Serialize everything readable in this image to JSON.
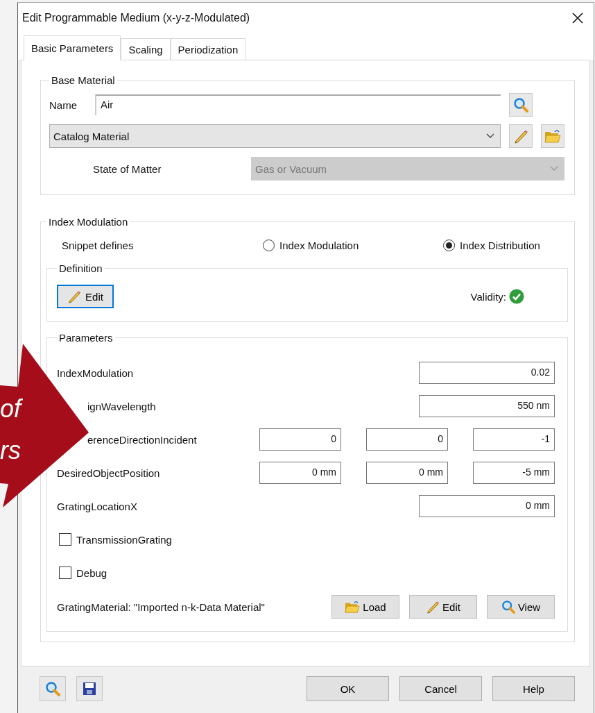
{
  "window": {
    "title": "Edit Programmable Medium (x-y-z-Modulated)"
  },
  "tabs": [
    {
      "label": "Basic Parameters",
      "selected": true
    },
    {
      "label": "Scaling",
      "selected": false
    },
    {
      "label": "Periodization",
      "selected": false
    }
  ],
  "base_material": {
    "title": "Base Material",
    "name_label": "Name",
    "name_value": "Air",
    "catalog": "Catalog Material",
    "state_label": "State of Matter",
    "state_value": "Gas or Vacuum",
    "state_disabled": true
  },
  "index_modulation": {
    "title": "Index Modulation",
    "snippet_label": "Snippet defines",
    "options": [
      {
        "label": "Index Modulation",
        "selected": false
      },
      {
        "label": "Index Distribution",
        "selected": true
      }
    ],
    "definition": {
      "title": "Definition",
      "edit_button": "Edit",
      "validity_label": "Validity:",
      "valid": true
    },
    "parameters": {
      "title": "Parameters",
      "rows": [
        {
          "kind": "inputs",
          "label": "IndexModulation",
          "partly_hidden": false,
          "values": [
            "0.02"
          ]
        },
        {
          "kind": "inputs",
          "label": "ignWavelength",
          "partly_hidden": true,
          "values": [
            "550 nm"
          ]
        },
        {
          "kind": "inputs",
          "label": "erenceDirectionIncident",
          "partly_hidden": true,
          "values": [
            "0",
            "0",
            "-1"
          ]
        },
        {
          "kind": "inputs",
          "label": "DesiredObjectPosition",
          "partly_hidden": false,
          "values": [
            "0 mm",
            "0 mm",
            "-5 mm"
          ]
        },
        {
          "kind": "inputs",
          "label": "GratingLocationX",
          "partly_hidden": false,
          "values": [
            "0 mm"
          ]
        },
        {
          "kind": "checkbox",
          "label": "TransmissionGrating",
          "checked": false
        },
        {
          "kind": "checkbox",
          "label": "Debug",
          "checked": false
        },
        {
          "kind": "material",
          "label": "GratingMaterial: \"Imported n-k-Data Material\"",
          "buttons": [
            {
              "kind": "load",
              "label": "Load"
            },
            {
              "kind": "edit",
              "label": "Edit"
            },
            {
              "kind": "view",
              "label": "View"
            }
          ]
        }
      ]
    }
  },
  "footer": {
    "buttons": [
      "OK",
      "Cancel",
      "Help"
    ]
  },
  "overlay_arrow": {
    "lines": [
      "of",
      "rs"
    ]
  }
}
